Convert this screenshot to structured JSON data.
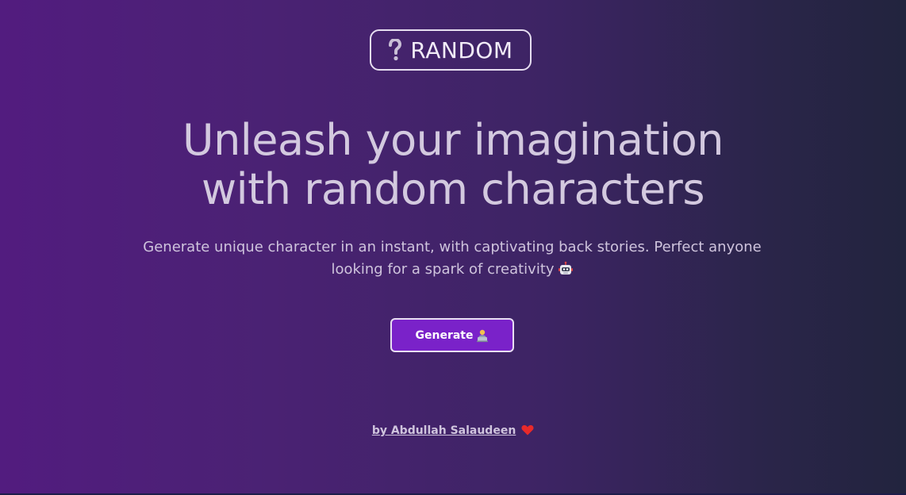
{
  "logo": {
    "icon": "question-mark-icon",
    "text": "RANDOM"
  },
  "hero": {
    "headline_line1": "Unleash your imagination",
    "headline_line2": "with random characters",
    "subtitle": "Generate unique character in an instant, with captivating back stories. Perfect anyone looking for a spark of creativity",
    "subtitle_icon": "robot-icon"
  },
  "generate_button": {
    "label": "Generate",
    "icon": "person-at-computer-icon",
    "color": "#7a22c9"
  },
  "footer": {
    "credit": "by Abdullah Salaudeen",
    "icon": "heart-icon",
    "heart_color": "#e82a2a"
  },
  "colors": {
    "background_start": "#521c7f",
    "background_end": "#22243e"
  }
}
